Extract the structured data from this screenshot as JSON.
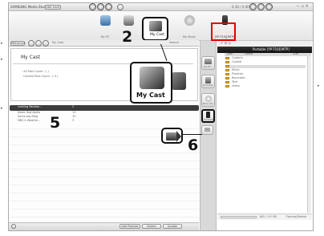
{
  "app": {
    "title": "SAMSUNG Media Studio",
    "device_pill": "ONE EASY",
    "device_meter": "0.30 / 0.00"
  },
  "toolbar": {
    "tabs": [
      {
        "label": "My PC",
        "icon": "monitor-icon"
      },
      {
        "label": "My Album",
        "icon": "album-icon"
      },
      {
        "label": "My Cast",
        "icon": "cast-icon"
      },
      {
        "label": "My Music",
        "icon": "music-icon"
      },
      {
        "label": "[YP-T10][MTP]",
        "icon": "player-icon"
      }
    ]
  },
  "nav": {
    "back_label": "PREVIOUS",
    "location": "My Cast",
    "nav_search": "Search"
  },
  "mycast": {
    "header": "My Cast",
    "all_post_label": "· All Post Count : ( )",
    "unread_label": "· Unread Post Count : ( 0 )"
  },
  "feed": {
    "rows": [
      {
        "name": "ranking Review...",
        "count": "2"
      },
      {
        "name": "News Highlights",
        "count": "12"
      },
      {
        "name": "Samsung Blog",
        "count": "10"
      },
      {
        "name": "MBC's Weathe...",
        "count": "3"
      }
    ]
  },
  "bottom": {
    "btn1": "Add Podcast",
    "btn2": "Delete",
    "btn3": "Update"
  },
  "side": {
    "items": [
      {
        "label": "My PC",
        "icon": "pc-icon"
      },
      {
        "label": "Portable",
        "icon": "portable-icon"
      },
      {
        "label": "Burn CD",
        "icon": "cd-icon"
      },
      {
        "label": "Portable",
        "icon": "device-icon"
      }
    ]
  },
  "right": {
    "title": "Portable [YP-T10][MTP]",
    "col1": "Type",
    "col2": "Name",
    "col3": "Size",
    "folders": [
      "Capture",
      "Copied",
      "",
      "Music",
      "Playlists",
      "Recorded",
      "Text",
      "Video"
    ],
    "capacity": "180 / 1.9 GB",
    "format_label": "Format/Delete"
  },
  "callouts": {
    "my_cast_label": "My Cast",
    "num2": "2",
    "num5": "5",
    "num6": "6"
  },
  "colors": {
    "accent_red": "#e30000",
    "dark": "#111111"
  }
}
